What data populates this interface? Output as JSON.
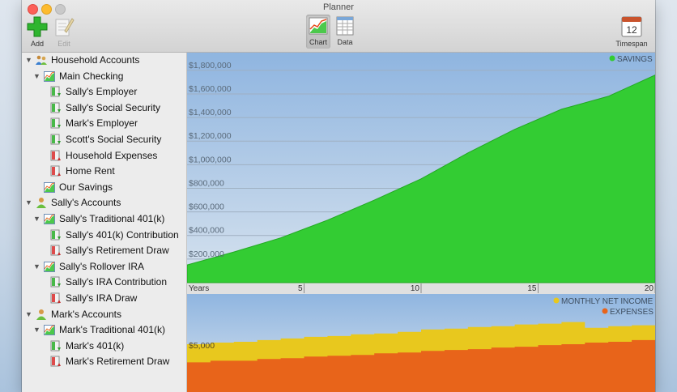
{
  "window": {
    "title": "Planner"
  },
  "toolbar": {
    "add_label": "Add",
    "edit_label": "Edit",
    "chart_label": "Chart",
    "data_label": "Data",
    "timespan_label": "Timespan",
    "timespan_value": "12"
  },
  "sidebar": {
    "items": [
      {
        "label": "Household Accounts",
        "level": 0,
        "disclosure": true,
        "icon": "household-icon"
      },
      {
        "label": "Main Checking",
        "level": 1,
        "disclosure": true,
        "icon": "account-chart-icon"
      },
      {
        "label": "Sally's Employer",
        "level": 2,
        "disclosure": false,
        "icon": "income-icon"
      },
      {
        "label": "Sally's Social Security",
        "level": 2,
        "disclosure": false,
        "icon": "income-icon"
      },
      {
        "label": "Mark's Employer",
        "level": 2,
        "disclosure": false,
        "icon": "income-icon"
      },
      {
        "label": "Scott's Social Security",
        "level": 2,
        "disclosure": false,
        "icon": "income-icon"
      },
      {
        "label": "Household Expenses",
        "level": 2,
        "disclosure": false,
        "icon": "expense-icon"
      },
      {
        "label": "Home Rent",
        "level": 2,
        "disclosure": false,
        "icon": "expense-icon"
      },
      {
        "label": "Our Savings",
        "level": 1,
        "disclosure": false,
        "icon": "account-chart-icon"
      },
      {
        "label": "Sally's Accounts",
        "level": 0,
        "disclosure": true,
        "icon": "person-icon"
      },
      {
        "label": "Sally's Traditional 401(k)",
        "level": 1,
        "disclosure": true,
        "icon": "account-chart-icon"
      },
      {
        "label": "Sally's 401(k) Contribution",
        "level": 2,
        "disclosure": false,
        "icon": "income-icon"
      },
      {
        "label": "Sally's Retirement Draw",
        "level": 2,
        "disclosure": false,
        "icon": "expense-icon"
      },
      {
        "label": "Sally's Rollover IRA",
        "level": 1,
        "disclosure": true,
        "icon": "account-chart-icon"
      },
      {
        "label": "Sally's IRA Contribution",
        "level": 2,
        "disclosure": false,
        "icon": "income-icon"
      },
      {
        "label": "Sally's IRA Draw",
        "level": 2,
        "disclosure": false,
        "icon": "expense-icon"
      },
      {
        "label": "Mark's Accounts",
        "level": 0,
        "disclosure": true,
        "icon": "person-icon"
      },
      {
        "label": "Mark's Traditional 401(k)",
        "level": 1,
        "disclosure": true,
        "icon": "account-chart-icon"
      },
      {
        "label": "Mark's 401(k)",
        "level": 2,
        "disclosure": false,
        "icon": "income-icon"
      },
      {
        "label": "Mark's Retirement Draw",
        "level": 2,
        "disclosure": false,
        "icon": "expense-icon"
      }
    ]
  },
  "colors": {
    "savings": "#33cc33",
    "net_income": "#e8c81e",
    "expenses": "#e8641a",
    "sky_top": "#8fb5e0",
    "sky_bottom": "#d6e2ee"
  },
  "chart_data": [
    {
      "type": "area",
      "legend": [
        "SAVINGS"
      ],
      "legend_position": "top-right",
      "xlabel": "Years",
      "x_ticks": [
        5,
        10,
        15,
        20
      ],
      "xlim": [
        0,
        20
      ],
      "y_ticks": [
        "$200,000",
        "$400,000",
        "$600,000",
        "$800,000",
        "$1,000,000",
        "$1,200,000",
        "$1,400,000",
        "$1,600,000",
        "$1,800,000"
      ],
      "y_tick_values": [
        200000,
        400000,
        600000,
        800000,
        1000000,
        1200000,
        1400000,
        1600000,
        1800000
      ],
      "ylim": [
        0,
        1950000
      ],
      "grid": true,
      "series": [
        {
          "name": "SAVINGS",
          "x": [
            0,
            2,
            4,
            6,
            8,
            10,
            12,
            14,
            16,
            18,
            20
          ],
          "values": [
            150000,
            260000,
            380000,
            530000,
            700000,
            880000,
            1100000,
            1300000,
            1470000,
            1580000,
            1760000
          ]
        }
      ]
    },
    {
      "type": "area",
      "stacked": true,
      "legend": [
        "MONTHLY NET INCOME",
        "EXPENSES"
      ],
      "legend_position": "top-right",
      "y_ticks": [
        "$5,000"
      ],
      "y_tick_values": [
        5000
      ],
      "ylim": [
        0,
        12000
      ],
      "grid": true,
      "x": [
        0,
        1,
        2,
        3,
        4,
        5,
        6,
        7,
        8,
        9,
        10,
        11,
        12,
        13,
        14,
        15,
        16,
        17,
        18,
        19,
        20
      ],
      "series": [
        {
          "name": "EXPENSES",
          "values": [
            3600,
            3800,
            3800,
            4000,
            4100,
            4300,
            4400,
            4500,
            4700,
            4800,
            5000,
            5100,
            5200,
            5400,
            5500,
            5700,
            5800,
            6000,
            6100,
            6300,
            6500
          ]
        },
        {
          "name": "MONTHLY NET INCOME",
          "values": [
            5800,
            6000,
            6100,
            6300,
            6500,
            6700,
            6800,
            7000,
            7100,
            7300,
            7600,
            7700,
            7900,
            8000,
            8200,
            8300,
            8500,
            7800,
            8000,
            8100,
            8300
          ]
        }
      ]
    }
  ]
}
